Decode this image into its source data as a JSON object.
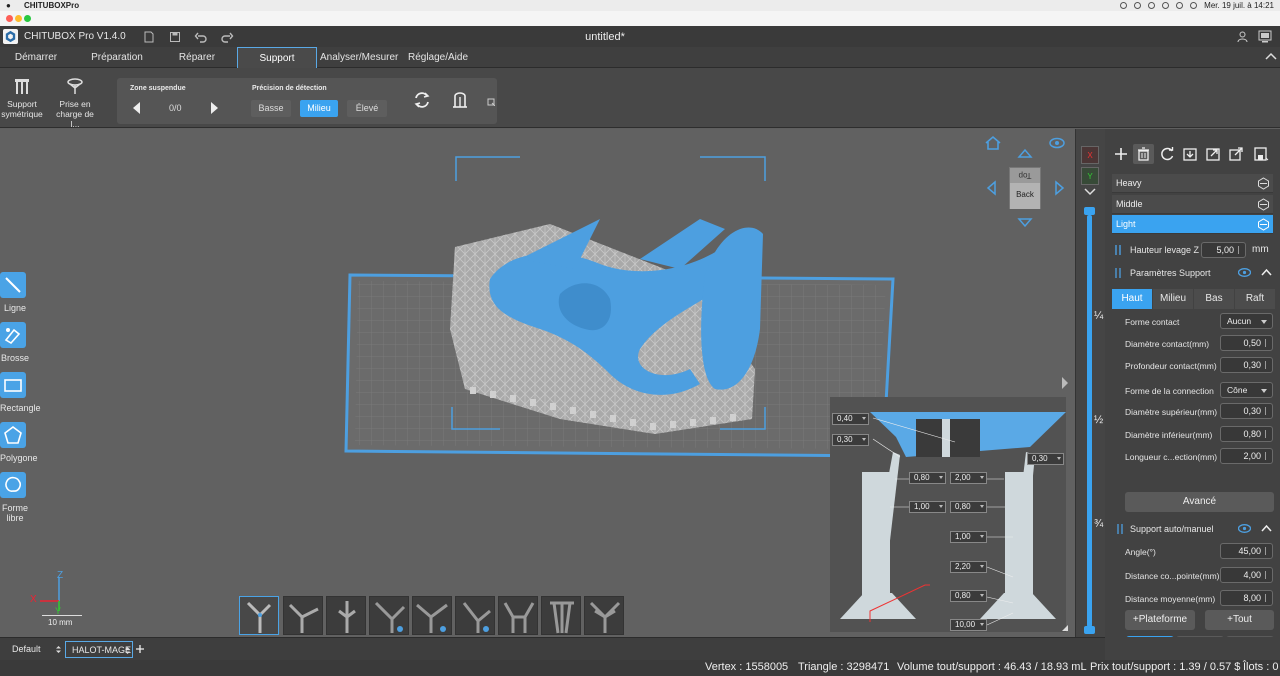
{
  "menubar": {
    "app": "CHITUBOXPro",
    "clock": "Mer. 19 juil. à 14:21"
  },
  "titlebar": {
    "app_version": "CHITUBOX Pro V1.4.0",
    "document": "untitled*"
  },
  "tabs": [
    {
      "label": "Démarrer"
    },
    {
      "label": "Préparation"
    },
    {
      "label": "Réparer"
    },
    {
      "label": "Support",
      "active": true
    },
    {
      "label": "Analyser/Mesurer"
    },
    {
      "label": "Réglage/Aide"
    }
  ],
  "toolbar": {
    "support_sym": [
      "Support",
      "symétrique"
    ],
    "prise": [
      "Prise en",
      "charge de l..."
    ],
    "zone_label": "Zone suspendue",
    "zone_count": "0/0",
    "precision_label": "Précision de détection",
    "precision": [
      "Basse",
      "Milieu",
      "Élevé"
    ],
    "precision_selected": "Milieu"
  },
  "left_tools": [
    {
      "label": "Ligne",
      "icon": "line-icon"
    },
    {
      "label": "Brosse",
      "icon": "brush-icon"
    },
    {
      "label": "Rectangle",
      "icon": "rectangle-icon"
    },
    {
      "label": "Polygone",
      "icon": "polygon-icon"
    },
    {
      "label": "Forme libre",
      "icon": "freeform-icon"
    }
  ],
  "view_cube": {
    "top": "Top",
    "front": "Back"
  },
  "axes": {
    "x": "X",
    "y": "Y",
    "z": "Z",
    "scale": "10 mm"
  },
  "inset": {
    "values": [
      "0,40",
      "0,30",
      "0,30",
      "0,80",
      "2,00",
      "1,00",
      "0,80",
      "1,00",
      "2,20",
      "0,80",
      "10,00"
    ]
  },
  "slider": {
    "q1": "¼",
    "half": "½",
    "q3": "¾"
  },
  "colors": {
    "accent": "#3aa3f0",
    "model": "#4d9fe0",
    "support": "#c2c2c2"
  },
  "right_panel": {
    "profiles": [
      {
        "name": "Heavy"
      },
      {
        "name": "Middle"
      },
      {
        "name": "Light",
        "active": true
      }
    ],
    "lift": {
      "label": "Hauteur levage Z",
      "value": "5,00",
      "unit": "mm"
    },
    "support_params": "Paramètres Support",
    "subtabs": [
      "Haut",
      "Milieu",
      "Bas",
      "Raft"
    ],
    "subtab_active": "Haut",
    "params": [
      {
        "label": "Forme contact",
        "value": "Aucun",
        "type": "select"
      },
      {
        "label": "Diamètre contact(mm)",
        "value": "0,50",
        "type": "spin"
      },
      {
        "label": "Profondeur contact(mm)",
        "value": "0,30",
        "type": "spin"
      },
      {
        "label": "Forme de la connection",
        "value": "Cône",
        "type": "select"
      },
      {
        "label": "Diamètre supérieur(mm)",
        "value": "0,30",
        "type": "spin"
      },
      {
        "label": "Diamètre inférieur(mm)",
        "value": "0,80",
        "type": "spin"
      },
      {
        "label": "Longueur c...ection(mm)",
        "value": "2,00",
        "type": "spin"
      }
    ],
    "advanced": "Avancé",
    "auto_manual": "Support auto/manuel",
    "auto_params": [
      {
        "label": "Angle(°)",
        "value": "45,00"
      },
      {
        "label": "Distance co...pointe(mm)",
        "value": "4,00"
      },
      {
        "label": "Distance moyenne(mm)",
        "value": "8,00"
      }
    ],
    "plateforme": "+Plateforme",
    "tout": "+Tout"
  },
  "scenes": {
    "default": "Default",
    "model": "HALOT-MAGE"
  },
  "status": {
    "vertex": "Vertex : 1558005",
    "triangle": "Triangle : 3298471",
    "volume": "Volume tout/support : 46.43 / 18.93 mL",
    "price": "Prix tout/support : 1.39 / 0.57 $",
    "islands": "Îlots : 0"
  }
}
